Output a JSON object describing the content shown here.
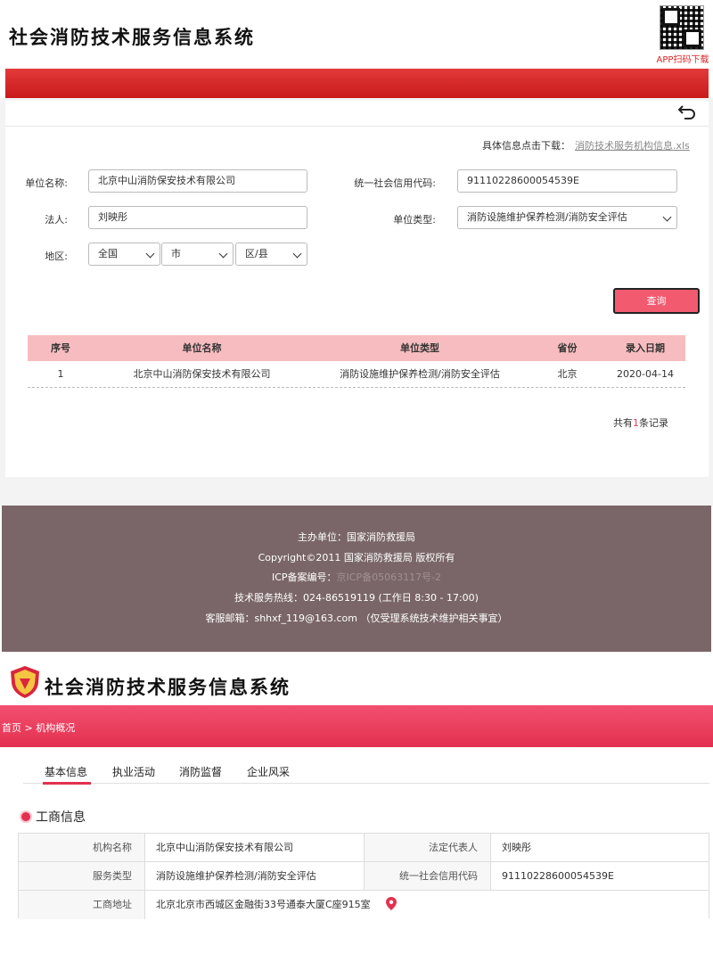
{
  "top": {
    "title": "社会消防技术服务信息系统",
    "qr_label": "APP扫码下载"
  },
  "download": {
    "text": "具体信息点击下载：",
    "link": "消防技术服务机构信息.xls"
  },
  "form": {
    "unit_name_label": "单位名称:",
    "unit_name_value": "北京中山消防保安技术有限公司",
    "credit_code_label": "统一社会信用代码:",
    "credit_code_value": "91110228600054539E",
    "legal_person_label": "法人:",
    "legal_person_value": "刘映彤",
    "unit_type_label": "单位类型:",
    "unit_type_value": "消防设施维护保养检测/消防安全评估",
    "region_label": "地区:",
    "region_country": "全国",
    "region_city": "市",
    "region_county": "区/县",
    "query_button": "查询"
  },
  "table": {
    "headers": [
      "序号",
      "单位名称",
      "单位类型",
      "省份",
      "录入日期"
    ],
    "rows": [
      [
        "1",
        "北京中山消防保安技术有限公司",
        "消防设施维护保养检测/消防安全评估",
        "北京",
        "2020-04-14"
      ]
    ],
    "total_prefix": "共有",
    "total_count": "1",
    "total_suffix": "条记录"
  },
  "footer": {
    "host": "主办单位：国家消防救援局",
    "copyright": "Copyright©2011 国家消防救援局 版权所有",
    "icp_label": "ICP备案编号：",
    "icp_value": "京ICP备05063117号-2",
    "hotline": "技术服务热线：024-86519119 (工作日 8:30 - 17:00)",
    "email": "客服邮箱：shhxf_119@163.com （仅受理系统技术维护相关事宜）"
  },
  "detail": {
    "title": "社会消防技术服务信息系统",
    "breadcrumb": "首页 > 机构概况",
    "tabs": [
      "基本信息",
      "执业活动",
      "消防监督",
      "企业风采"
    ],
    "section_title": "工商信息",
    "org_name_label": "机构名称",
    "org_name_value": "北京中山消防保安技术有限公司",
    "legal_rep_label": "法定代表人",
    "legal_rep_value": "刘映彤",
    "service_type_label": "服务类型",
    "service_type_value": "消防设施维护保养检测/消防安全评估",
    "credit_code_label": "统一社会信用代码",
    "credit_code_value": "91110228600054539E",
    "address_label": "工商地址",
    "address_value": "北京北京市西城区金融街33号通泰大厦C座915室"
  },
  "colors": {
    "accent_red": "#e3304f",
    "table_header": "#f7bcbf",
    "footer_bg": "#7a6668"
  },
  "icons": [
    "qr-code",
    "back-arrow-icon",
    "chevron-down-icon",
    "shield-logo-icon",
    "location-pin-icon"
  ]
}
